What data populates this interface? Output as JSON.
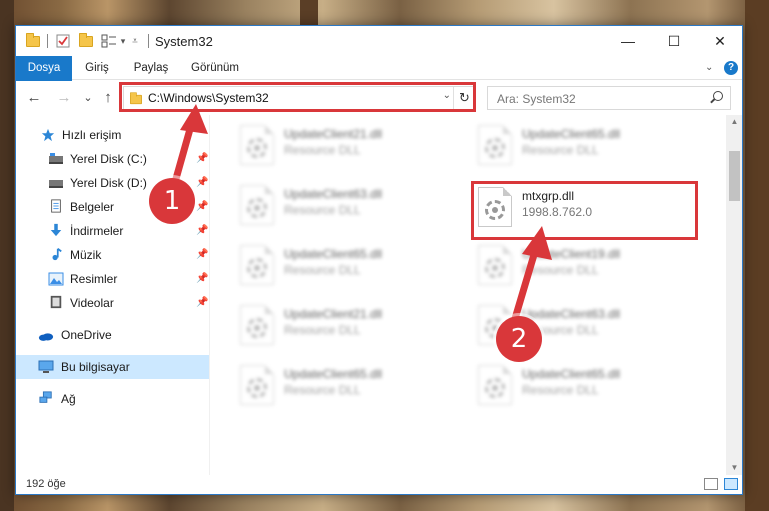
{
  "window": {
    "title": "System32",
    "controls": {
      "minimize": "—",
      "maximize": "☐",
      "close": "✕"
    }
  },
  "ribbon": {
    "tabs": [
      "Dosya",
      "Giriş",
      "Paylaş",
      "Görünüm"
    ],
    "help": "?"
  },
  "navbar": {
    "back": "←",
    "forward": "→",
    "recent": "⌄",
    "up": "↑",
    "address_path": "C:\\Windows\\System32",
    "refresh": "↻",
    "search_placeholder": "Ara: System32"
  },
  "sidebar": {
    "items": [
      {
        "label": "Hızlı erişim",
        "icon": "star-icon",
        "pinned": false
      },
      {
        "label": "Yerel Disk (C:)",
        "icon": "drive-c-icon",
        "pinned": true
      },
      {
        "label": "Yerel Disk (D:)",
        "icon": "drive-d-icon",
        "pinned": true
      },
      {
        "label": "Belgeler",
        "icon": "documents-icon",
        "pinned": true
      },
      {
        "label": "İndirmeler",
        "icon": "downloads-icon",
        "pinned": true
      },
      {
        "label": "Müzik",
        "icon": "music-icon",
        "pinned": true
      },
      {
        "label": "Resimler",
        "icon": "pictures-icon",
        "pinned": true
      },
      {
        "label": "Videolar",
        "icon": "videos-icon",
        "pinned": true
      },
      {
        "label": "OneDrive",
        "icon": "onedrive-icon",
        "pinned": false
      },
      {
        "label": "Bu bilgisayar",
        "icon": "this-pc-icon",
        "pinned": false,
        "selected": true
      },
      {
        "label": "Ağ",
        "icon": "network-icon",
        "pinned": false
      }
    ],
    "pin_glyph": "📌"
  },
  "files": {
    "left_column": [
      {
        "name": "UpdateClient21.dll",
        "desc": "Resource DLL"
      },
      {
        "name": "UpdateClient63.dll",
        "desc": "Resource DLL"
      },
      {
        "name": "UpdateClient65.dll",
        "desc": "Resource DLL"
      },
      {
        "name": "UpdateClient21.dll",
        "desc": "Resource DLL"
      },
      {
        "name": "UpdateClient65.dll",
        "desc": "Resource DLL"
      }
    ],
    "right_column": [
      {
        "name": "UpdateClient65.dll",
        "desc": "Resource DLL"
      },
      {
        "name": "mtxgrp.dll",
        "desc": "1998.8.762.0",
        "highlighted": true
      },
      {
        "name": "UpdateClient19.dll",
        "desc": "Resource DLL"
      },
      {
        "name": "UpdateClient63.dll",
        "desc": "Resource DLL"
      },
      {
        "name": "UpdateClient65.dll",
        "desc": "Resource DLL"
      }
    ]
  },
  "status": {
    "item_count": "192 öğe"
  },
  "annotations": {
    "badge_1": "1",
    "badge_2": "2",
    "color": "#d9373a"
  },
  "colors": {
    "accent": "#1979ca",
    "selection": "#cce8ff"
  }
}
